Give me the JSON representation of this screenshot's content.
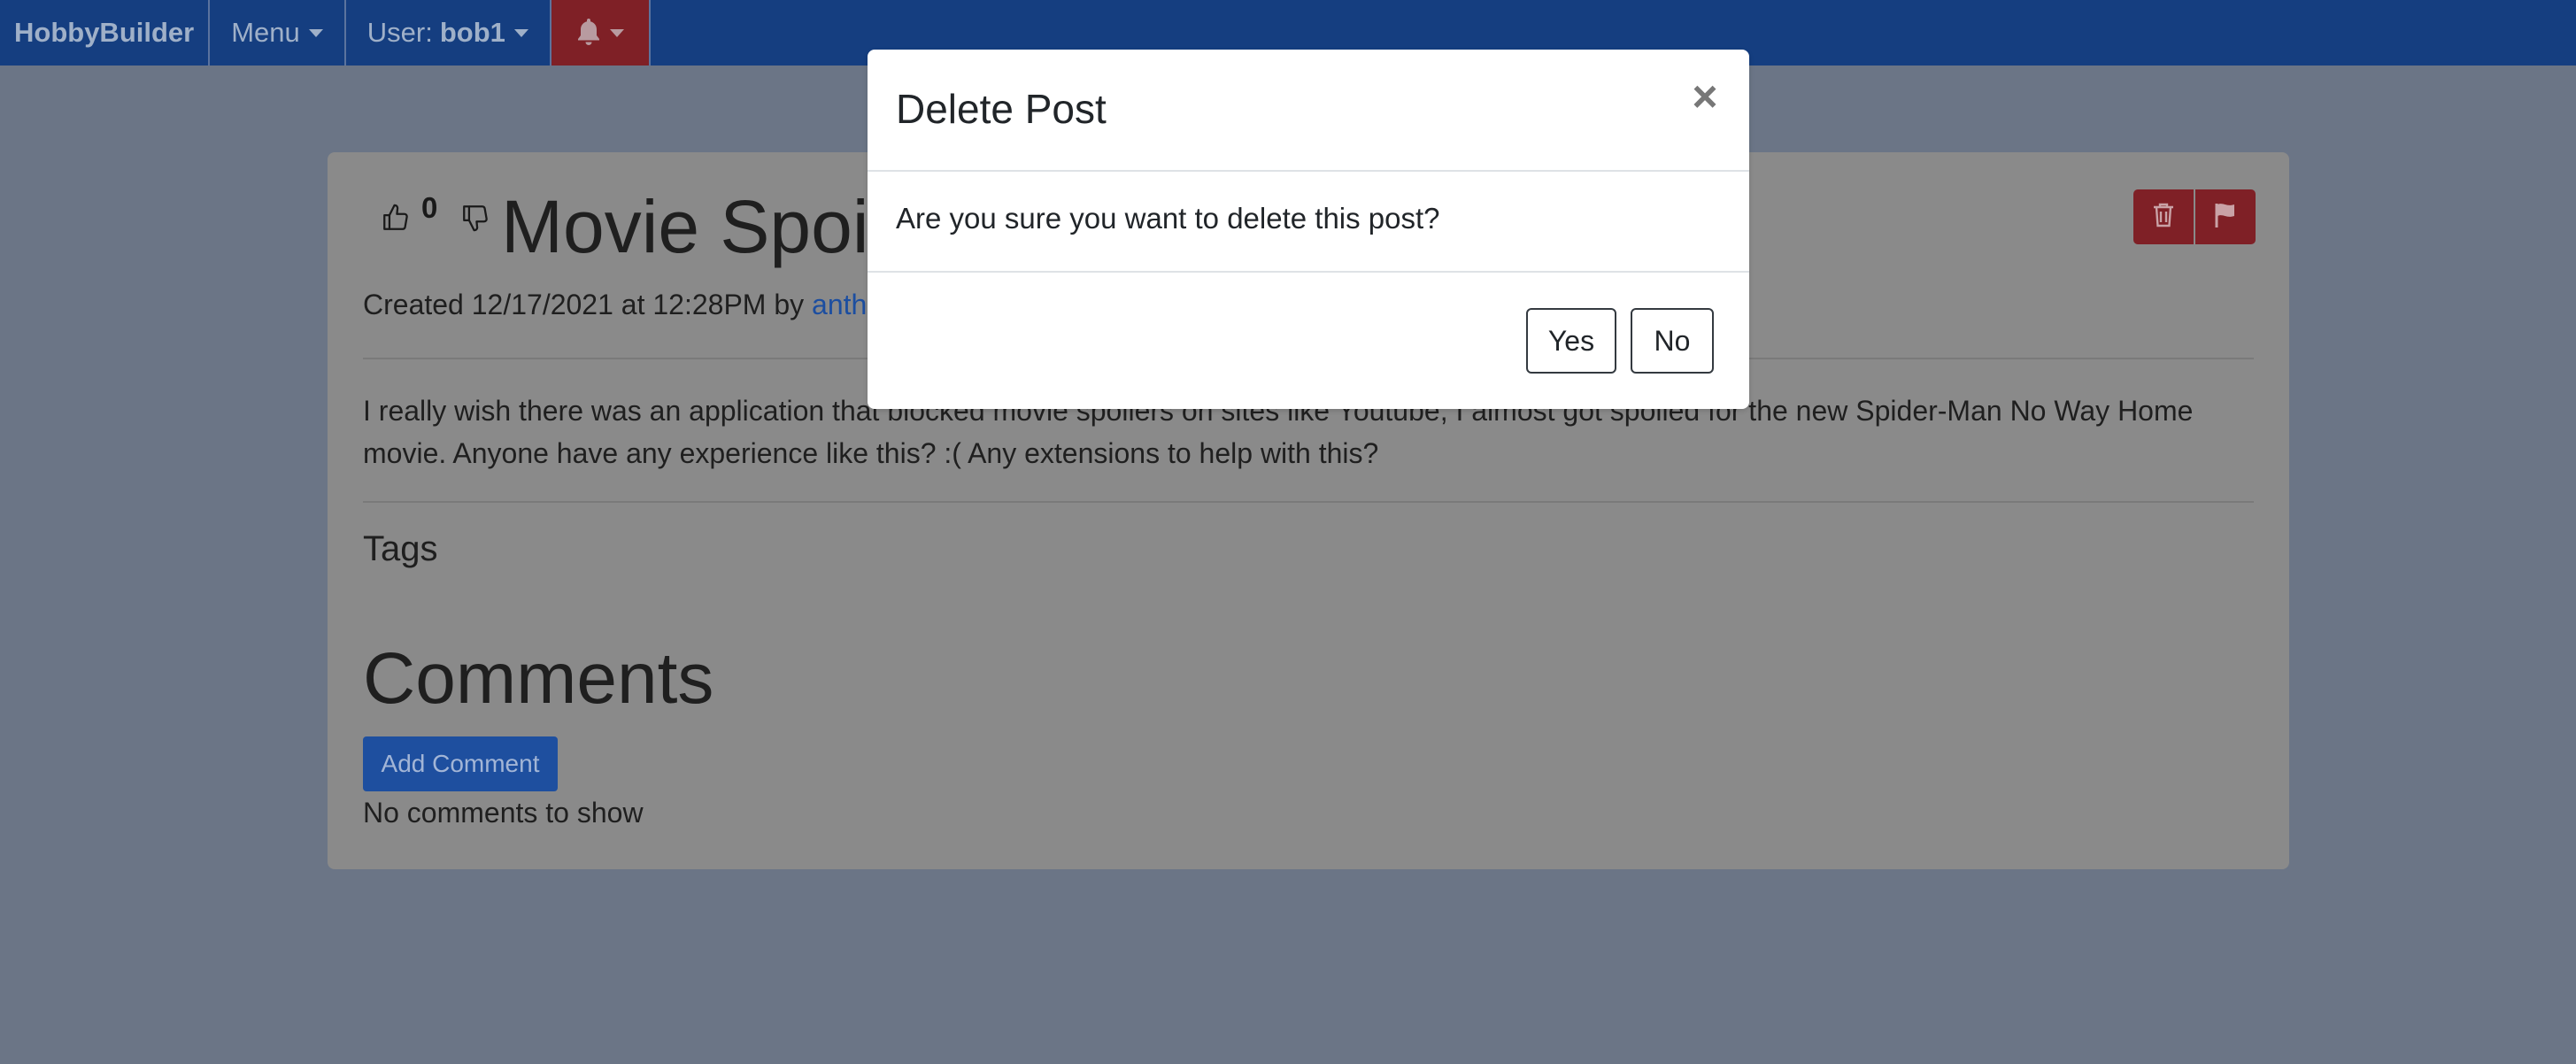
{
  "navbar": {
    "brand": "HobbyBuilder",
    "menu_label": "Menu",
    "user_prefix": "User:",
    "username": "bob1",
    "notifications_icon": "bell-icon"
  },
  "post": {
    "vote_count": "0",
    "title": "Movie Spoile",
    "meta_prefix": "Created 12/17/2021 at 12:28PM by",
    "author": "anth",
    "body": "I really wish there was an application that blocked movie spoilers on sites like Youtube, I almost got spoiled for the new Spider-Man No Way Home movie. Anyone have any experience like this? :( Any extensions to help with this?",
    "tags_heading": "Tags",
    "comments_heading": "Comments",
    "add_comment_label": "Add Comment",
    "no_comments": "No comments to show",
    "delete_icon": "trash-icon",
    "flag_icon": "flag-icon"
  },
  "modal": {
    "title": "Delete Post",
    "close": "×",
    "message": "Are you sure you want to delete this post?",
    "yes_label": "Yes",
    "no_label": "No"
  },
  "colors": {
    "navbar": "#153e80",
    "danger": "#7f2026",
    "primary": "#1e4f9f",
    "backdrop": "#6b7586"
  }
}
